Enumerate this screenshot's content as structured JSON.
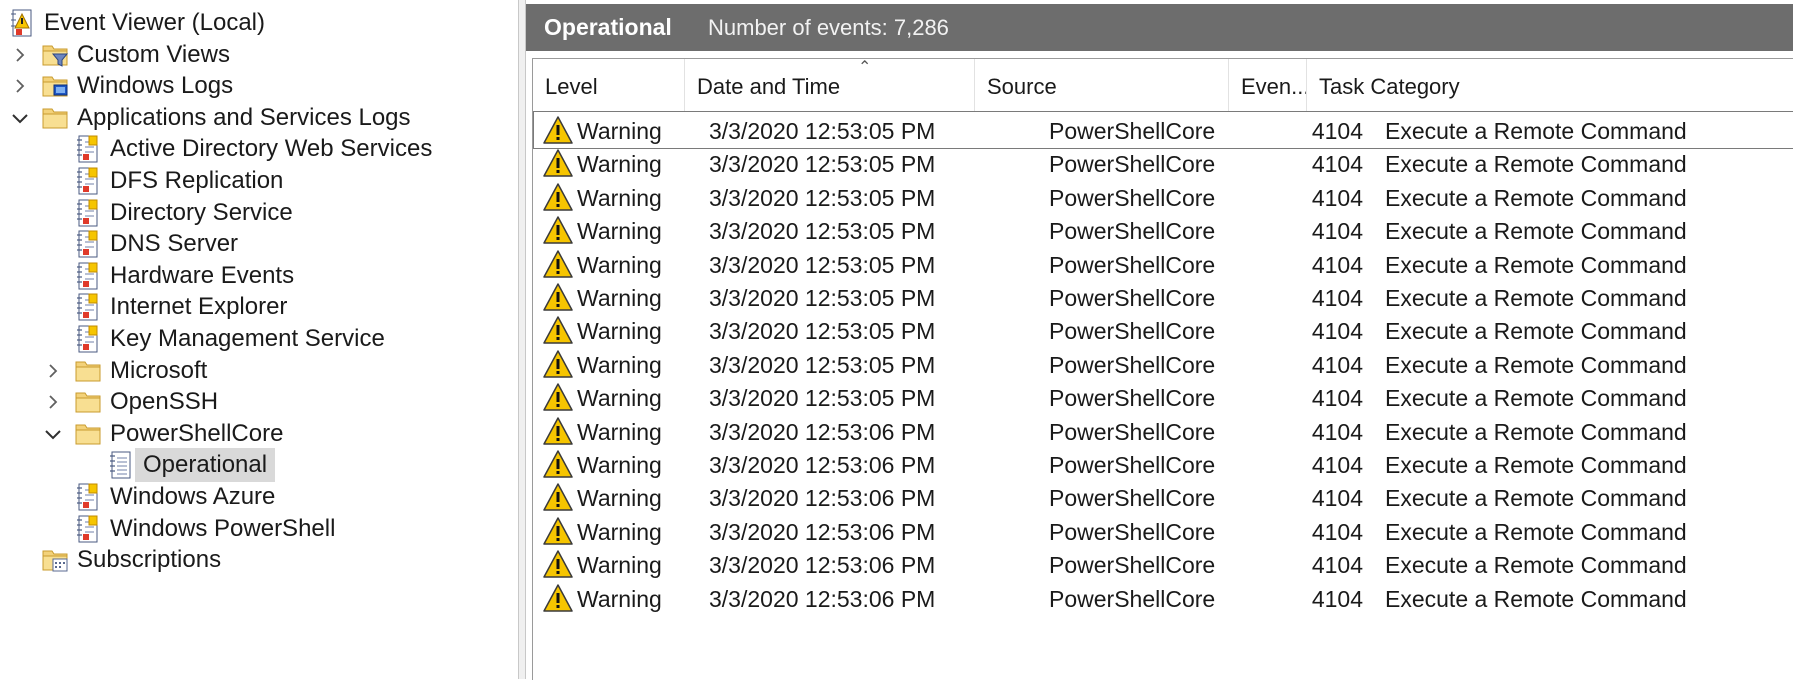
{
  "tree": {
    "items": [
      {
        "label": "Event Viewer (Local)",
        "icon": "event-viewer-icon",
        "chevron": "none"
      },
      {
        "label": "Custom Views",
        "icon": "folder-filter-icon",
        "chevron": "right"
      },
      {
        "label": "Windows Logs",
        "icon": "folder-windows-logs-icon",
        "chevron": "right"
      },
      {
        "label": "Applications and Services Logs",
        "icon": "folder-icon",
        "chevron": "down"
      },
      {
        "label": "Active Directory Web Services",
        "icon": "log-icon",
        "chevron": "none"
      },
      {
        "label": "DFS Replication",
        "icon": "log-icon",
        "chevron": "none"
      },
      {
        "label": "Directory Service",
        "icon": "log-icon",
        "chevron": "none"
      },
      {
        "label": "DNS Server",
        "icon": "log-icon",
        "chevron": "none"
      },
      {
        "label": "Hardware Events",
        "icon": "log-icon",
        "chevron": "none"
      },
      {
        "label": "Internet Explorer",
        "icon": "log-icon",
        "chevron": "none"
      },
      {
        "label": "Key Management Service",
        "icon": "log-icon",
        "chevron": "none"
      },
      {
        "label": "Microsoft",
        "icon": "folder-icon",
        "chevron": "right"
      },
      {
        "label": "OpenSSH",
        "icon": "folder-icon",
        "chevron": "right"
      },
      {
        "label": "PowerShellCore",
        "icon": "folder-icon",
        "chevron": "down"
      },
      {
        "label": "Operational",
        "icon": "operational-log-icon",
        "chevron": "none",
        "selected": true
      },
      {
        "label": "Windows Azure",
        "icon": "log-icon",
        "chevron": "none"
      },
      {
        "label": "Windows PowerShell",
        "icon": "log-icon",
        "chevron": "none"
      },
      {
        "label": "Subscriptions",
        "icon": "subscriptions-icon",
        "chevron": "none"
      }
    ]
  },
  "header": {
    "log_name": "Operational",
    "event_count": "Number of events: 7,286"
  },
  "columns": [
    "Level",
    "Date and Time",
    "Source",
    "Even...",
    "Task Category"
  ],
  "events": [
    {
      "level": "Warning",
      "datetime": "3/3/2020 12:53:05 PM",
      "source": "PowerShellCore",
      "event_id": "4104",
      "task": "Execute a Remote Command"
    },
    {
      "level": "Warning",
      "datetime": "3/3/2020 12:53:05 PM",
      "source": "PowerShellCore",
      "event_id": "4104",
      "task": "Execute a Remote Command"
    },
    {
      "level": "Warning",
      "datetime": "3/3/2020 12:53:05 PM",
      "source": "PowerShellCore",
      "event_id": "4104",
      "task": "Execute a Remote Command"
    },
    {
      "level": "Warning",
      "datetime": "3/3/2020 12:53:05 PM",
      "source": "PowerShellCore",
      "event_id": "4104",
      "task": "Execute a Remote Command"
    },
    {
      "level": "Warning",
      "datetime": "3/3/2020 12:53:05 PM",
      "source": "PowerShellCore",
      "event_id": "4104",
      "task": "Execute a Remote Command"
    },
    {
      "level": "Warning",
      "datetime": "3/3/2020 12:53:05 PM",
      "source": "PowerShellCore",
      "event_id": "4104",
      "task": "Execute a Remote Command"
    },
    {
      "level": "Warning",
      "datetime": "3/3/2020 12:53:05 PM",
      "source": "PowerShellCore",
      "event_id": "4104",
      "task": "Execute a Remote Command"
    },
    {
      "level": "Warning",
      "datetime": "3/3/2020 12:53:05 PM",
      "source": "PowerShellCore",
      "event_id": "4104",
      "task": "Execute a Remote Command"
    },
    {
      "level": "Warning",
      "datetime": "3/3/2020 12:53:05 PM",
      "source": "PowerShellCore",
      "event_id": "4104",
      "task": "Execute a Remote Command"
    },
    {
      "level": "Warning",
      "datetime": "3/3/2020 12:53:06 PM",
      "source": "PowerShellCore",
      "event_id": "4104",
      "task": "Execute a Remote Command"
    },
    {
      "level": "Warning",
      "datetime": "3/3/2020 12:53:06 PM",
      "source": "PowerShellCore",
      "event_id": "4104",
      "task": "Execute a Remote Command"
    },
    {
      "level": "Warning",
      "datetime": "3/3/2020 12:53:06 PM",
      "source": "PowerShellCore",
      "event_id": "4104",
      "task": "Execute a Remote Command"
    },
    {
      "level": "Warning",
      "datetime": "3/3/2020 12:53:06 PM",
      "source": "PowerShellCore",
      "event_id": "4104",
      "task": "Execute a Remote Command"
    },
    {
      "level": "Warning",
      "datetime": "3/3/2020 12:53:06 PM",
      "source": "PowerShellCore",
      "event_id": "4104",
      "task": "Execute a Remote Command"
    },
    {
      "level": "Warning",
      "datetime": "3/3/2020 12:53:06 PM",
      "source": "PowerShellCore",
      "event_id": "4104",
      "task": "Execute a Remote Command"
    }
  ],
  "colors": {
    "title_bar": "#6d6d6d",
    "selection": "#d9d9d9",
    "warning_yellow": "#f6c500"
  }
}
